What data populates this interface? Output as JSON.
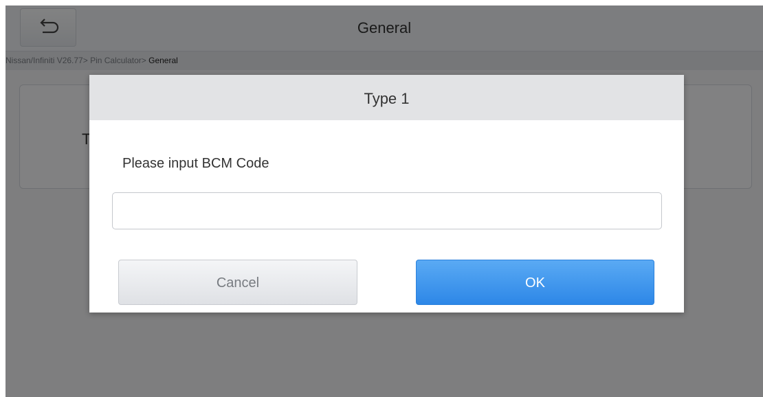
{
  "header": {
    "title": "General",
    "back_icon": "back-arrow-icon"
  },
  "breadcrumb": {
    "path": "Nissan/Infiniti V26.77> Pin Calculator> ",
    "current": "General"
  },
  "background_card": {
    "label_visible_fragment": "T"
  },
  "dialog": {
    "title": "Type 1",
    "prompt": "Please input BCM Code",
    "input_value": "",
    "cancel_label": "Cancel",
    "ok_label": "OK"
  },
  "colors": {
    "ok_button": "#2d87e7",
    "overlay": "rgba(0,0,0,0.48)"
  }
}
